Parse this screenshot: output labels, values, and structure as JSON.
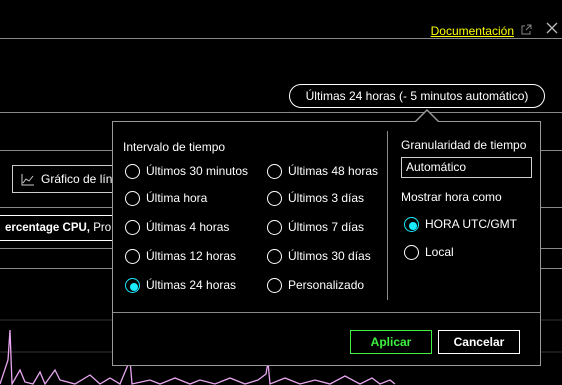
{
  "header": {
    "doc_link": "Documentación",
    "ext_icon": "external-link-icon",
    "close_icon": "close-icon"
  },
  "time_range": {
    "label": "Últimas 24 horas (- 5 minutos automático)"
  },
  "toolbar": {
    "chart_button": "Gráfico de lín",
    "chart_icon": "line-chart-icon"
  },
  "metric": {
    "bold": "ercentage CPU,",
    "rest": " Pro"
  },
  "time_picker": {
    "interval_label": "Intervalo de tiempo",
    "options_left": [
      "Últimos 30 minutos",
      "Última hora",
      "Últimas 4 horas",
      "Últimas 12 horas",
      "Últimas 24 horas"
    ],
    "options_right": [
      "Últimas 48 horas",
      "Últimos 3 días",
      "Últimos 7 días",
      "Últimos 30 días",
      "Personalizado"
    ],
    "selected": "Últimas 24 horas",
    "granularity_label": "Granularidad de tiempo",
    "granularity_value": "Automático",
    "show_time_label": "Mostrar hora como",
    "time_zones": [
      "HORA UTC/GMT",
      "Local"
    ],
    "time_zone_selected": "HORA UTC/GMT",
    "apply": "Aplicar",
    "cancel": "Cancelar"
  },
  "colors": {
    "link": "#ffff00",
    "selected_radio": "#1aebff",
    "apply": "#3ff23f",
    "chart_line": "#e8a6f0"
  }
}
